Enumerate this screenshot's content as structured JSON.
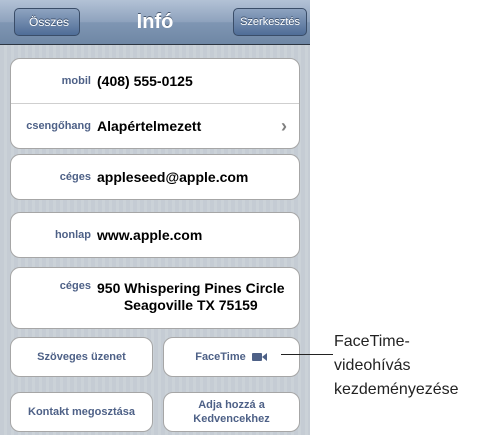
{
  "navbar": {
    "back_label": "Összes",
    "title": "Infó",
    "edit_label": "Szerkesztés"
  },
  "phone_group": {
    "mobile_label": "mobil",
    "mobile_value": "(408) 555-0125",
    "ringtone_label": "csengőhang",
    "ringtone_value": "Alapértelmezett"
  },
  "email": {
    "label": "céges",
    "value": "appleseed@apple.com"
  },
  "homepage": {
    "label": "honlap",
    "value": "www.apple.com"
  },
  "address": {
    "label": "céges",
    "line1": "950 Whispering Pines Circle",
    "line2": "Seagoville TX 75159"
  },
  "actions": {
    "text_message": "Szöveges üzenet",
    "facetime": "FaceTime",
    "share_contact": "Kontakt megosztása",
    "add_favorite_line1": "Adja hozzá a",
    "add_favorite_line2": "Kedvencekhez"
  },
  "callout": {
    "line1": "FaceTime-",
    "line2": "videohívás",
    "line3": "kezdeményezése"
  },
  "colors": {
    "label_blue": "#4e6187",
    "background_stripes": "#c5ccd4"
  }
}
